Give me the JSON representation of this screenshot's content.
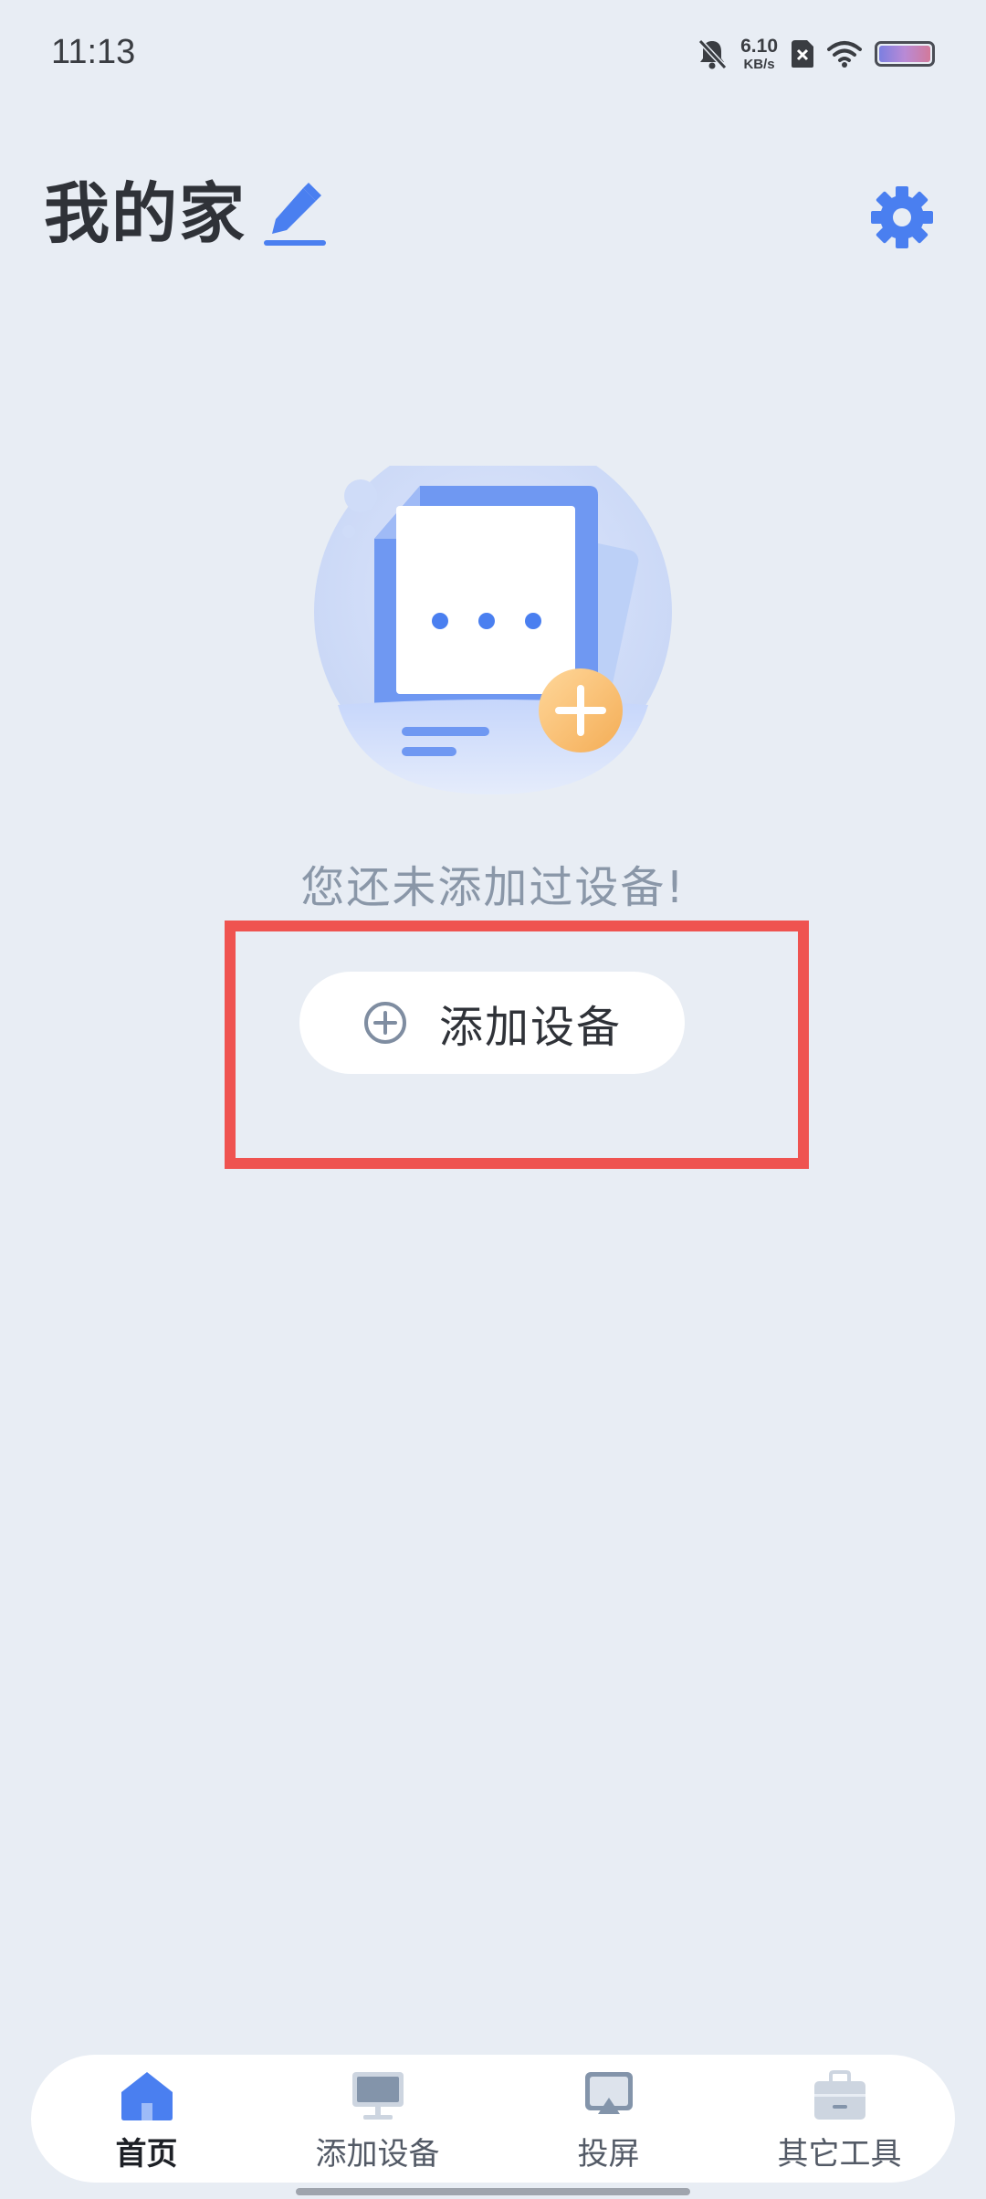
{
  "status_bar": {
    "time": "11:13",
    "net_speed_value": "6.10",
    "net_speed_unit": "KB/s",
    "icons": [
      "bell-muted-icon",
      "sim-off-icon",
      "wifi-icon",
      "battery-icon"
    ]
  },
  "header": {
    "title": "我的家",
    "edit_icon": "pencil-icon",
    "settings_icon": "gear-icon"
  },
  "empty_state": {
    "message": "您还未添加过设备!",
    "button_label": "添加设备"
  },
  "bottom_nav": {
    "items": [
      {
        "label": "首页",
        "icon": "home-icon",
        "active": true
      },
      {
        "label": "添加设备",
        "icon": "monitor-icon",
        "active": false
      },
      {
        "label": "投屏",
        "icon": "cast-screen-icon",
        "active": false
      },
      {
        "label": "其它工具",
        "icon": "toolbox-icon",
        "active": false
      }
    ]
  },
  "colors": {
    "background": "#e8edf4",
    "accent": "#4a7ff0",
    "highlight": "#ef5350",
    "plus_badge": "#f6b760"
  }
}
